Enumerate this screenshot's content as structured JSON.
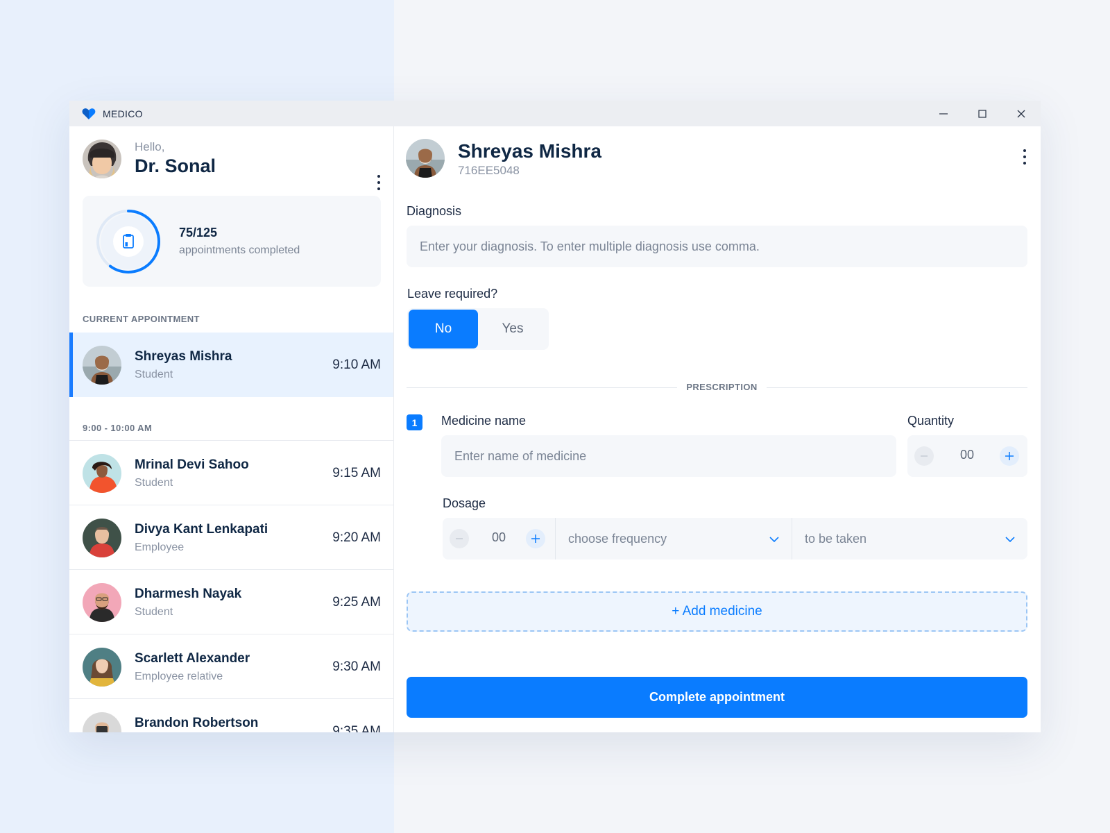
{
  "app": {
    "title": "MEDICO",
    "brand_color": "#0a7cff",
    "icons": [
      "heart-logo-icon",
      "minimize-icon",
      "maximize-icon",
      "close-icon"
    ]
  },
  "doctor": {
    "greeting": "Hello,",
    "name": "Dr. Sonal"
  },
  "progress": {
    "count": "75/125",
    "label": "appointments completed",
    "completed": 75,
    "total": 125
  },
  "current": {
    "section_label": "CURRENT APPOINTMENT",
    "name": "Shreyas Mishra",
    "role": "Student",
    "time": "9:10 AM"
  },
  "slot": {
    "label": "9:00 - 10:00 AM",
    "appointments": [
      {
        "name": "Mrinal Devi Sahoo",
        "role": "Student",
        "time": "9:15 AM"
      },
      {
        "name": "Divya Kant Lenkapati",
        "role": "Employee",
        "time": "9:20 AM"
      },
      {
        "name": "Dharmesh Nayak",
        "role": "Student",
        "time": "9:25 AM"
      },
      {
        "name": "Scarlett Alexander",
        "role": "Employee relative",
        "time": "9:30 AM"
      },
      {
        "name": "Brandon Robertson",
        "role": "",
        "time": "9:35 AM"
      }
    ]
  },
  "patient": {
    "name": "Shreyas Mishra",
    "id": "716EE5048"
  },
  "form": {
    "diagnosis_label": "Diagnosis",
    "diagnosis_placeholder": "Enter your diagnosis. To enter multiple diagnosis use comma.",
    "leave_label": "Leave required?",
    "leave_no": "No",
    "leave_yes": "Yes",
    "leave_selected": "No",
    "prescription_label": "PRESCRIPTION",
    "medicine_index": "1",
    "medicine_label": "Medicine name",
    "medicine_placeholder": "Enter name of medicine",
    "quantity_label": "Quantity",
    "quantity_value": "00",
    "dosage_label": "Dosage",
    "dosage_value": "00",
    "frequency_placeholder": "choose frequency",
    "taken_placeholder": "to be taken",
    "add_medicine": "+ Add medicine",
    "complete_button": "Complete appointment"
  }
}
